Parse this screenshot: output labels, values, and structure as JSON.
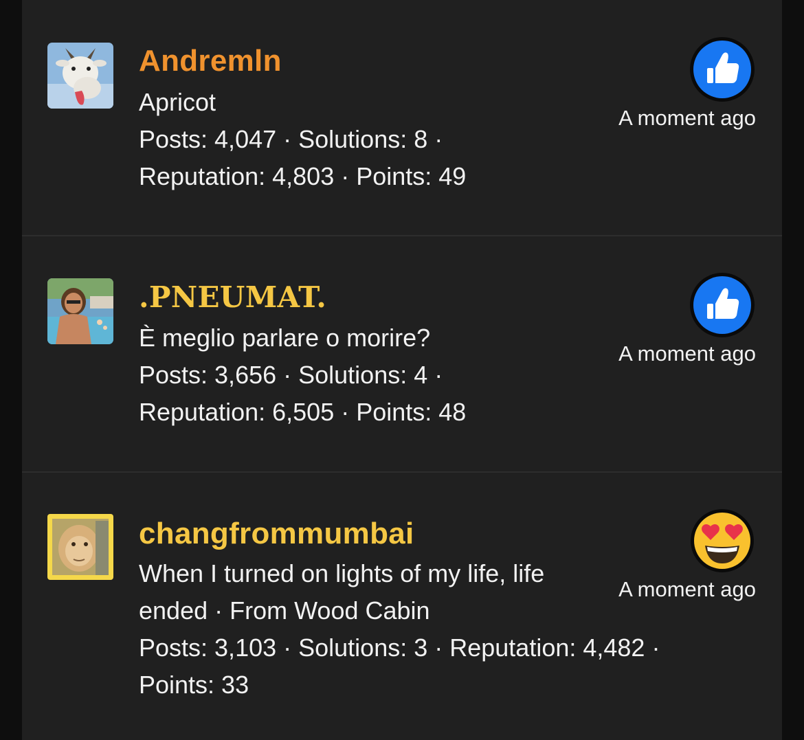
{
  "colors": {
    "panel_bg": "#202020",
    "name_orange": "#f0922e",
    "name_yellow": "#f5c744",
    "like_blue": "#1877f2"
  },
  "members": [
    {
      "username": "Andremln",
      "title": "Apricot",
      "stats_line1": "Posts: 4,047 · Solutions: 8 ·",
      "stats_line2": "Reputation: 4,803 · Points: 49",
      "reaction": "thumbs-up-icon",
      "time": "A moment ago",
      "avatar": "goat-avatar"
    },
    {
      "username": ".PNEUMAT.",
      "title": "È meglio parlare o morire?",
      "stats_line1": "Posts: 3,656 · Solutions: 4 ·",
      "stats_line2": "Reputation: 6,505 · Points: 48",
      "reaction": "thumbs-up-icon",
      "time": "A moment ago",
      "avatar": "pool-man-avatar"
    },
    {
      "username": "changfrommumbai",
      "title": "When I turned on lights of my life, life",
      "title_cont": "ended · From Wood Cabin",
      "stats_line1": "Posts: 3,103 · Solutions: 3 · Reputation: 4,482 ·",
      "stats_line2": "Points: 33",
      "reaction": "heart-eyes-emoji-icon",
      "time": "A moment ago",
      "avatar": "monkey-avatar"
    }
  ]
}
